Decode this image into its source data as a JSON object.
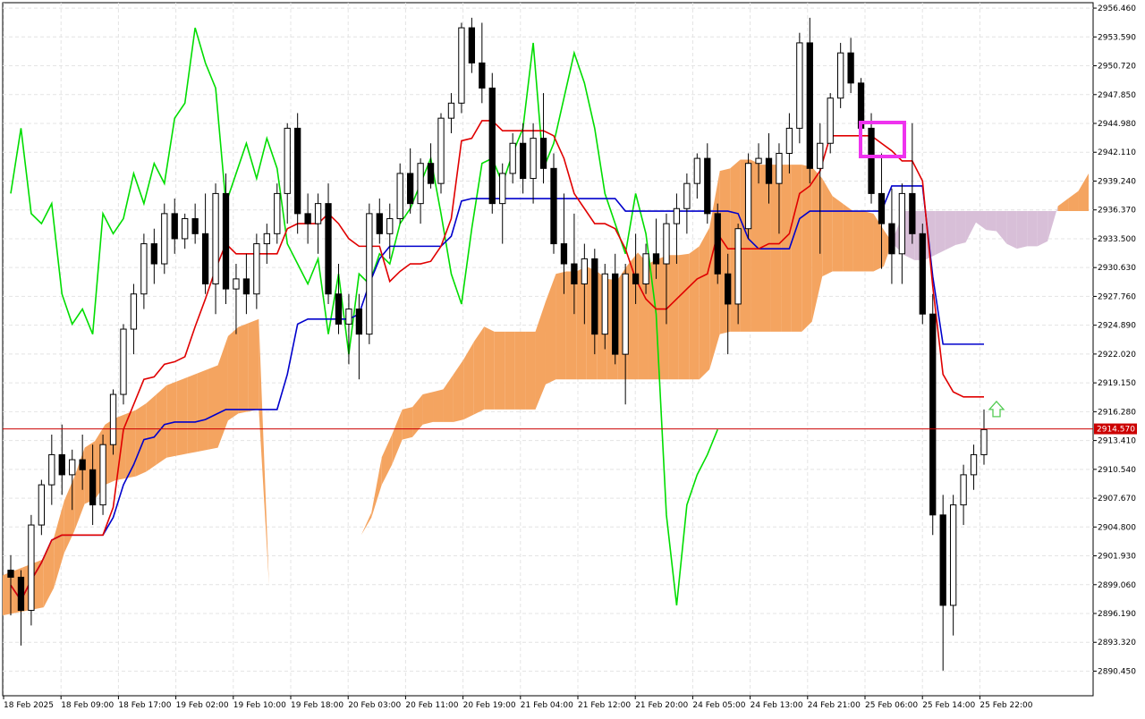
{
  "chart_data": {
    "type": "candlestick",
    "instrument_timeframe": "H1 (1-hour candles)",
    "indicator": "Ichimoku Kinko Hyo",
    "y_axis": {
      "min": 2888.0,
      "max": 2957.0,
      "ticks": [
        "2956.460",
        "2953.590",
        "2950.720",
        "2947.850",
        "2944.980",
        "2942.110",
        "2939.240",
        "2936.370",
        "2933.500",
        "2930.630",
        "2927.760",
        "2924.890",
        "2922.020",
        "2919.150",
        "2916.280",
        "2913.410",
        "2910.540",
        "2907.670",
        "2904.800",
        "2901.930",
        "2899.060",
        "2896.190",
        "2893.320",
        "2890.450"
      ]
    },
    "x_axis": {
      "labels": [
        "18 Feb 2025",
        "18 Feb 09:00",
        "18 Feb 17:00",
        "19 Feb 02:00",
        "19 Feb 10:00",
        "19 Feb 18:00",
        "20 Feb 03:00",
        "20 Feb 11:00",
        "20 Feb 19:00",
        "21 Feb 04:00",
        "21 Feb 12:00",
        "21 Feb 20:00",
        "24 Feb 05:00",
        "24 Feb 13:00",
        "24 Feb 21:00",
        "25 Feb 06:00",
        "25 Feb 14:00",
        "25 Feb 22:00"
      ]
    },
    "current_price": {
      "label": "2914.570",
      "value": 2914.57,
      "color": "#cc0000"
    },
    "grid": true,
    "colors": {
      "bull_candle": "#ffffff",
      "bear_candle": "#000000",
      "tenkan": "#e00000",
      "kijun": "#0000cc",
      "chikou": "#00dd00",
      "kumo_bull": "#f4a460",
      "kumo_bear": "#d8bfd8",
      "highlight_box": "#ee33ee",
      "arrow": "#55cc55"
    },
    "candles_approx": [
      [
        2900.5,
        2902.0,
        2896.0,
        2899.8
      ],
      [
        2899.8,
        2900.5,
        2893.0,
        2896.5
      ],
      [
        2896.5,
        2906.0,
        2895.0,
        2905.0
      ],
      [
        2905.0,
        2909.5,
        2904.0,
        2909.0
      ],
      [
        2909.0,
        2914.0,
        2907.0,
        2912.0
      ],
      [
        2912.0,
        2915.0,
        2908.0,
        2910.0
      ],
      [
        2910.0,
        2912.5,
        2906.5,
        2911.5
      ],
      [
        2911.5,
        2914.0,
        2908.5,
        2910.5
      ],
      [
        2910.5,
        2913.0,
        2905.0,
        2907.0
      ],
      [
        2907.0,
        2914.0,
        2906.0,
        2913.0
      ],
      [
        2913.0,
        2918.5,
        2912.0,
        2918.0
      ],
      [
        2918.0,
        2925.0,
        2917.0,
        2924.5
      ],
      [
        2924.5,
        2929.0,
        2922.0,
        2928.0
      ],
      [
        2928.0,
        2934.0,
        2926.5,
        2933.0
      ],
      [
        2933.0,
        2934.5,
        2929.0,
        2931.0
      ],
      [
        2931.0,
        2937.0,
        2930.0,
        2936.0
      ],
      [
        2936.0,
        2937.5,
        2932.0,
        2933.5
      ],
      [
        2933.5,
        2936.0,
        2932.5,
        2935.5
      ],
      [
        2935.5,
        2937.0,
        2933.0,
        2934.0
      ],
      [
        2934.0,
        2938.0,
        2928.0,
        2929.0
      ],
      [
        2929.0,
        2939.0,
        2926.0,
        2938.0
      ],
      [
        2938.0,
        2940.0,
        2927.0,
        2928.5
      ],
      [
        2928.5,
        2931.0,
        2924.0,
        2929.5
      ],
      [
        2929.5,
        2932.0,
        2926.0,
        2928.0
      ],
      [
        2928.0,
        2934.0,
        2926.5,
        2933.0
      ],
      [
        2933.0,
        2935.0,
        2931.0,
        2934.0
      ],
      [
        2934.0,
        2939.0,
        2933.0,
        2938.0
      ],
      [
        2938.0,
        2945.0,
        2935.0,
        2944.5
      ],
      [
        2944.5,
        2946.0,
        2934.0,
        2936.0
      ],
      [
        2936.0,
        2938.0,
        2933.0,
        2935.0
      ],
      [
        2935.0,
        2938.0,
        2932.0,
        2937.0
      ],
      [
        2937.0,
        2939.0,
        2927.0,
        2928.0
      ],
      [
        2928.0,
        2931.0,
        2924.0,
        2925.0
      ],
      [
        2925.0,
        2928.0,
        2921.0,
        2926.5
      ],
      [
        2926.5,
        2928.0,
        2919.5,
        2924.0
      ],
      [
        2924.0,
        2937.0,
        2923.0,
        2936.0
      ],
      [
        2936.0,
        2937.5,
        2933.0,
        2934.0
      ],
      [
        2934.0,
        2937.0,
        2931.5,
        2935.5
      ],
      [
        2935.5,
        2941.0,
        2935.0,
        2940.0
      ],
      [
        2940.0,
        2942.5,
        2936.0,
        2937.0
      ],
      [
        2937.0,
        2941.5,
        2935.0,
        2941.0
      ],
      [
        2941.0,
        2943.0,
        2938.5,
        2939.0
      ],
      [
        2939.0,
        2946.0,
        2938.0,
        2945.5
      ],
      [
        2945.5,
        2948.0,
        2944.0,
        2947.0
      ],
      [
        2947.0,
        2955.0,
        2946.0,
        2954.5
      ],
      [
        2954.5,
        2955.5,
        2950.0,
        2951.0
      ],
      [
        2951.0,
        2955.0,
        2947.0,
        2948.5
      ],
      [
        2948.5,
        2950.0,
        2936.0,
        2937.0
      ],
      [
        2937.0,
        2941.0,
        2933.0,
        2940.0
      ],
      [
        2940.0,
        2944.0,
        2939.0,
        2943.0
      ],
      [
        2943.0,
        2945.0,
        2938.0,
        2939.5
      ],
      [
        2939.5,
        2945.0,
        2937.0,
        2943.5
      ],
      [
        2943.5,
        2948.0,
        2939.0,
        2940.5
      ],
      [
        2940.5,
        2942.0,
        2932.0,
        2933.0
      ],
      [
        2933.0,
        2938.0,
        2928.0,
        2931.0
      ],
      [
        2931.0,
        2936.0,
        2926.0,
        2929.0
      ],
      [
        2929.0,
        2933.0,
        2925.0,
        2931.5
      ],
      [
        2931.5,
        2932.5,
        2922.0,
        2924.0
      ],
      [
        2924.0,
        2931.0,
        2922.5,
        2930.0
      ],
      [
        2930.0,
        2932.0,
        2921.0,
        2922.0
      ],
      [
        2922.0,
        2931.0,
        2917.0,
        2930.0
      ],
      [
        2930.0,
        2934.0,
        2927.0,
        2929.0
      ],
      [
        2929.0,
        2933.0,
        2928.0,
        2932.0
      ],
      [
        2932.0,
        2935.5,
        2929.5,
        2931.0
      ],
      [
        2931.0,
        2936.0,
        2925.0,
        2935.0
      ],
      [
        2935.0,
        2938.0,
        2931.0,
        2936.5
      ],
      [
        2936.5,
        2940.0,
        2934.0,
        2939.0
      ],
      [
        2939.0,
        2942.0,
        2937.5,
        2941.5
      ],
      [
        2941.5,
        2943.0,
        2935.0,
        2936.0
      ],
      [
        2936.0,
        2937.0,
        2929.0,
        2930.0
      ],
      [
        2930.0,
        2932.0,
        2922.0,
        2927.0
      ],
      [
        2927.0,
        2935.0,
        2925.0,
        2934.5
      ],
      [
        2934.5,
        2942.0,
        2933.5,
        2941.0
      ],
      [
        2941.0,
        2943.0,
        2939.0,
        2941.5
      ],
      [
        2941.5,
        2944.0,
        2937.0,
        2939.0
      ],
      [
        2939.0,
        2943.0,
        2934.0,
        2942.0
      ],
      [
        2942.0,
        2946.0,
        2940.0,
        2944.5
      ],
      [
        2944.5,
        2954.0,
        2943.0,
        2953.0
      ],
      [
        2953.0,
        2955.5,
        2939.0,
        2940.5
      ],
      [
        2940.5,
        2945.0,
        2932.0,
        2943.0
      ],
      [
        2943.0,
        2948.0,
        2942.0,
        2947.5
      ],
      [
        2947.5,
        2953.0,
        2946.5,
        2952.0
      ],
      [
        2952.0,
        2953.5,
        2948.0,
        2949.0
      ],
      [
        2949.0,
        2949.5,
        2943.5,
        2944.5
      ],
      [
        2944.5,
        2946.0,
        2937.0,
        2938.0
      ],
      [
        2938.0,
        2942.0,
        2930.5,
        2935.0
      ],
      [
        2935.0,
        2938.5,
        2929.0,
        2932.0
      ],
      [
        2932.0,
        2939.0,
        2929.0,
        2938.0
      ],
      [
        2938.0,
        2945.0,
        2933.0,
        2934.0
      ],
      [
        2934.0,
        2935.0,
        2925.0,
        2926.0
      ],
      [
        2926.0,
        2928.0,
        2904.0,
        2906.0
      ],
      [
        2906.0,
        2908.0,
        2890.5,
        2897.0
      ],
      [
        2897.0,
        2908.0,
        2894.0,
        2907.0
      ],
      [
        2907.0,
        2911.0,
        2905.0,
        2910.0
      ],
      [
        2910.0,
        2913.0,
        2908.5,
        2912.0
      ],
      [
        2912.0,
        2916.5,
        2911.0,
        2914.5
      ]
    ]
  }
}
